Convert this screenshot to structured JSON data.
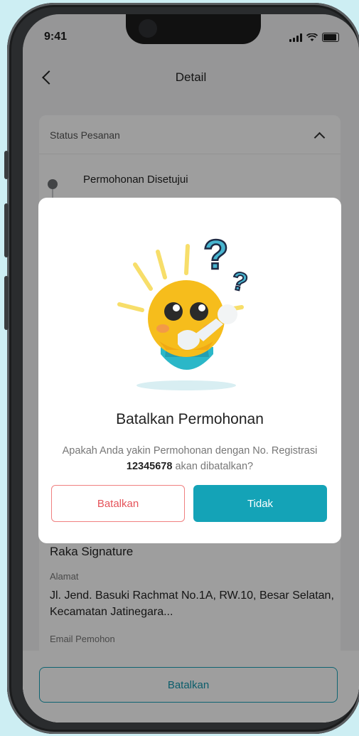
{
  "status_bar": {
    "time": "9:41"
  },
  "header": {
    "title": "Detail"
  },
  "order_status": {
    "label": "Status Pesanan",
    "steps": [
      {
        "label": "Permohonan Disetujui"
      }
    ]
  },
  "details": {
    "name": "Raka Signature",
    "address_label": "Alamat",
    "address_value": "Jl. Jend. Basuki Rachmat No.1A, RW.10, Besar Selatan, Kecamatan Jatinegara...",
    "email_label": "Email Pemohon"
  },
  "bottom": {
    "button_label": "Batalkan"
  },
  "modal": {
    "title": "Batalkan Permohonan",
    "desc_before": "Apakah Anda yakin Permohonan dengan No. Registrasi",
    "registration_no": "12345678",
    "desc_after": "akan dibatalkan?",
    "cancel_label": "Batalkan",
    "no_label": "Tidak"
  },
  "colors": {
    "accent": "#14a3b7",
    "danger": "#e5535a",
    "background": "#cdeef3"
  },
  "icons": [
    "back-icon",
    "chevron-up-icon",
    "signal-icon",
    "wifi-icon",
    "battery-icon",
    "lightbulb-illustration"
  ]
}
